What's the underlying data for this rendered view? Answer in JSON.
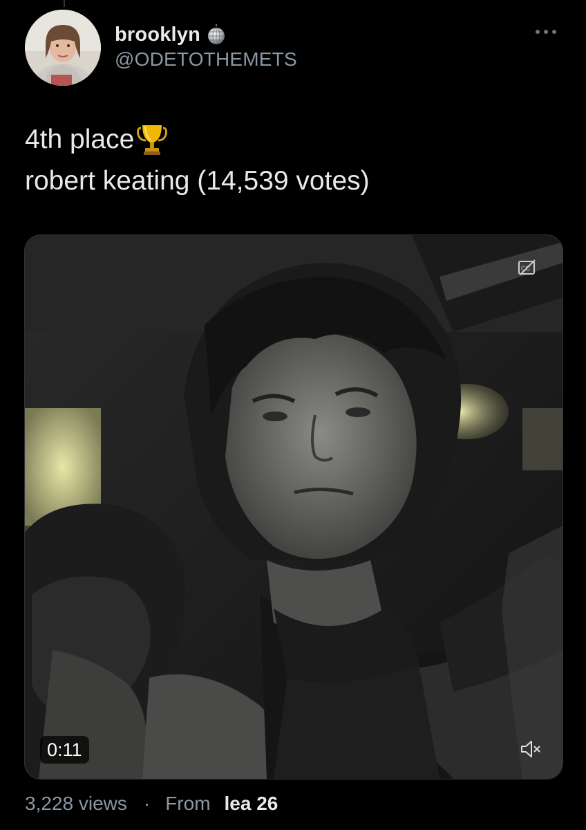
{
  "tweet": {
    "display_name": "brooklyn",
    "handle": "@ODETOTHEMETS",
    "name_badge_icon": "disco-ball-icon",
    "more_icon": "more-horizontal-icon",
    "text_line_1": "4th place",
    "text_line_1_emoji": "trophy-icon",
    "text_line_2": "robert keating (14,539 votes)"
  },
  "video": {
    "duration": "0:11",
    "cc_icon": "closed-captions-off-icon",
    "mute_icon": "volume-muted-icon"
  },
  "meta": {
    "views": "3,228 views",
    "separator": "·",
    "from_label": "From",
    "source": "lea 26"
  },
  "colors": {
    "background": "#000000",
    "primary_text": "#e7e9ea",
    "secondary_text": "#8b98a5",
    "border": "#2f3336"
  }
}
